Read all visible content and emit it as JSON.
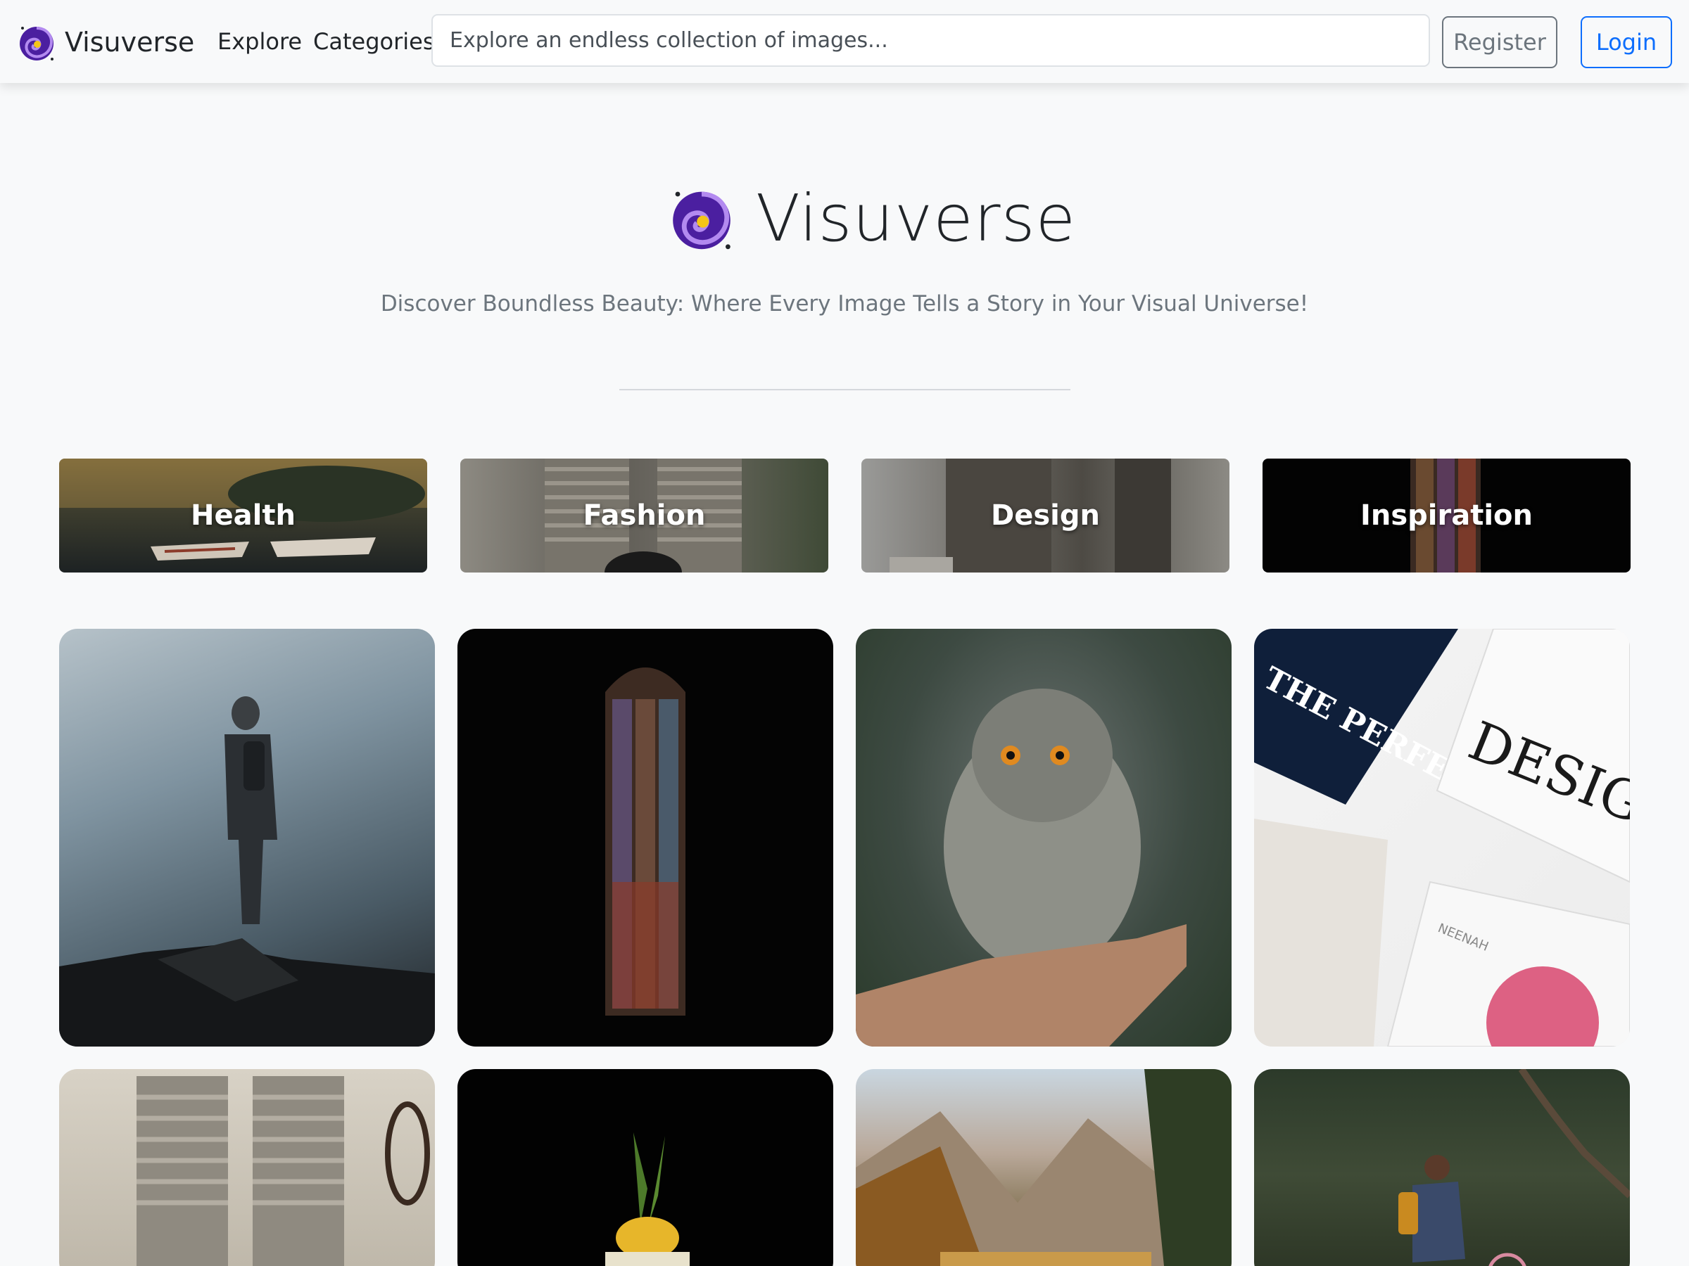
{
  "brand": {
    "name": "Visuverse",
    "logo_icon": "galaxy-icon"
  },
  "nav": {
    "explore": "Explore",
    "categories": "Categories"
  },
  "search": {
    "placeholder": "Explore an endless collection of images..."
  },
  "auth": {
    "register": "Register",
    "login": "Login"
  },
  "hero": {
    "title": "Visuverse",
    "subtitle": "Discover Boundless Beauty: Where Every Image Tells a Story in Your Visual Universe!"
  },
  "categories": [
    {
      "label": "Health"
    },
    {
      "label": "Fashion"
    },
    {
      "label": "Design"
    },
    {
      "label": "Inspiration"
    }
  ],
  "gallery": [
    {
      "subject": "hiker-on-rock"
    },
    {
      "subject": "stained-glass-window"
    },
    {
      "subject": "baby-owl-on-hand"
    },
    {
      "subject": "design-magazines"
    },
    {
      "subject": "wooden-shutters"
    },
    {
      "subject": "pineapple-drink"
    },
    {
      "subject": "mountain-lake"
    },
    {
      "subject": "cyclist-in-forest"
    }
  ],
  "design_tile_text": {
    "magazine_a": "THE PERFECT CANVAS",
    "magazine_b": "DESIG",
    "magazine_c": "NEENAH"
  },
  "colors": {
    "accent": "#0d6efd",
    "secondary": "#6c757d",
    "logo_purple": "#5b2bb5"
  }
}
